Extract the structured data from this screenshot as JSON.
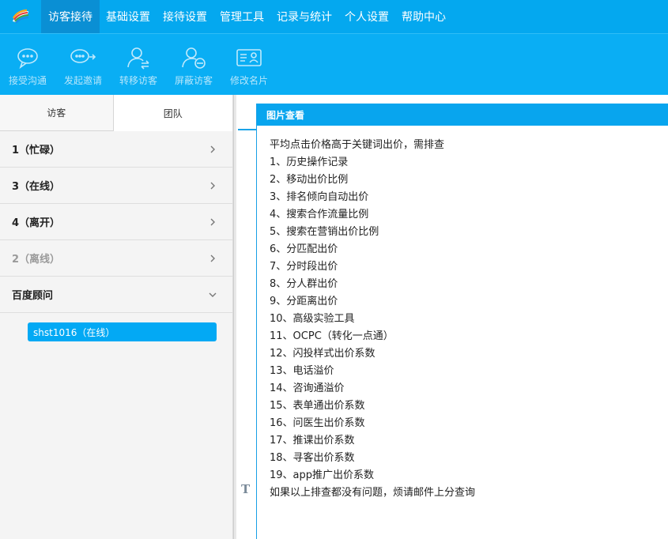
{
  "menu": {
    "items": [
      "访客接待",
      "基础设置",
      "接待设置",
      "管理工具",
      "记录与统计",
      "个人设置",
      "帮助中心"
    ]
  },
  "toolbar": {
    "items": [
      {
        "label": "接受沟通",
        "icon": "chat-bubble-icon"
      },
      {
        "label": "发起邀请",
        "icon": "invite-chat-icon"
      },
      {
        "label": "转移访客",
        "icon": "transfer-user-icon"
      },
      {
        "label": "屏蔽访客",
        "icon": "block-user-icon"
      },
      {
        "label": "修改名片",
        "icon": "edit-card-icon"
      }
    ]
  },
  "left": {
    "tabs": [
      "访客",
      "团队"
    ],
    "groups": [
      "1（忙碌）",
      "3（在线）",
      "4（离开）",
      "2（离线）",
      "百度顾问"
    ],
    "member": "shst1016（在线）"
  },
  "viewer": {
    "title": "图片查看",
    "lines": [
      "平均点击价格高于关键词出价，需排查",
      "1、历史操作记录",
      "2、移动出价比例",
      "3、排名倾向自动出价",
      "4、搜索合作流量比例",
      "5、搜索在营销出价比例",
      "6、分匹配出价",
      "7、分时段出价",
      "8、分人群出价",
      "9、分距离出价",
      "10、高级实验工具",
      "11、OCPC（转化一点通）",
      "12、闪投样式出价系数",
      "13、电话溢价",
      "14、咨询通溢价",
      "15、表单通出价系数",
      "16、问医生出价系数",
      "17、推课出价系数",
      "18、寻客出价系数",
      "19、app推广出价系数",
      "如果以上排查都没有问题，烦请邮件上分查询"
    ]
  },
  "text_tool": "T",
  "colors": {
    "menubar": "#04a8ef",
    "active_menu": "#0a8fd4",
    "toolbar": "#0aaef4",
    "accent": "#03a9f4"
  }
}
